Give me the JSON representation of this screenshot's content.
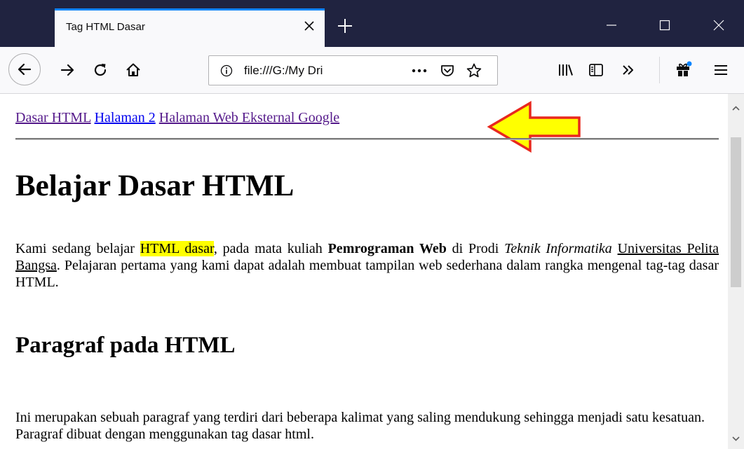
{
  "window": {
    "tab_title": "Tag HTML Dasar"
  },
  "navbar": {
    "url_scheme_icon": "info-icon",
    "url_text": "file:///G:/My Dri"
  },
  "page": {
    "links": [
      {
        "label": "Dasar HTML",
        "state": "visited"
      },
      {
        "label": "Halaman 2",
        "state": "unvisited"
      },
      {
        "label": "Halaman Web Eksternal Google",
        "state": "visited"
      }
    ],
    "heading": "Belajar Dasar HTML",
    "paragraph1": {
      "t1": "Kami sedang belajar ",
      "highlight": "HTML dasar",
      "t2": ", pada mata kuliah ",
      "bold": "Pemrograman Web",
      "t3": " di Prodi ",
      "italic": "Teknik Informatika",
      "t4": " ",
      "underline": "Universitas Pelita Bangsa",
      "t5": ". Pelajaran pertama yang kami dapat adalah membuat tampilan web sederhana dalam rangka mengenal tag-tag dasar HTML."
    },
    "subheading": "Paragraf pada HTML",
    "paragraph2": "Ini merupakan sebuah paragraf yang terdiri dari beberapa kalimat yang saling mendukung sehingga menjadi satu kesatuan. Paragraf dibuat dengan menggunakan tag dasar html."
  },
  "colors": {
    "titlebar": "#202340",
    "tab_accent": "#0a84ff",
    "link_visited": "#551a8b",
    "link_unvisited": "#0000ee",
    "highlight": "#ffff00",
    "annotation_arrow_fill": "#ffff00",
    "annotation_arrow_stroke": "#e8281e"
  },
  "icons": [
    "close-icon",
    "plus-icon",
    "minimize-icon",
    "maximize-icon",
    "window-close-icon",
    "back-icon",
    "forward-icon",
    "reload-icon",
    "home-icon",
    "info-icon",
    "more-icon",
    "pocket-icon",
    "star-icon",
    "library-icon",
    "sidebar-icon",
    "overflow-icon",
    "gift-icon",
    "menu-icon"
  ]
}
